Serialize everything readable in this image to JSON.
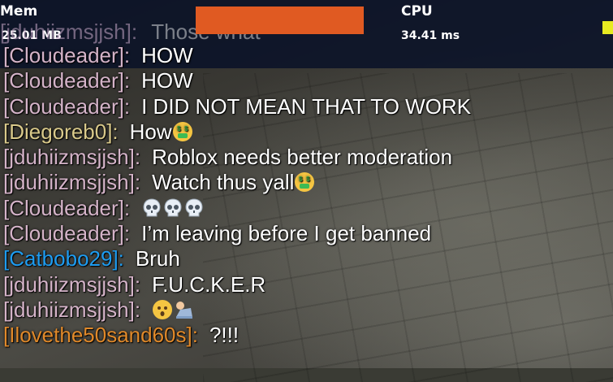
{
  "stats": {
    "mem_label": "Mem",
    "mem_value": "25.01 MB",
    "cpu_label": "CPU",
    "cpu_value": "34.41 ms"
  },
  "partial_line": {
    "name": "[jduhiizmsjjsh]:",
    "text": "Those what"
  },
  "messages": [
    {
      "name": "[Cloudeader]:",
      "text": "HOW",
      "name_color": "#d4b3c8"
    },
    {
      "name": "[Cloudeader]:",
      "text": "HOW",
      "name_color": "#d4b3c8"
    },
    {
      "name": "[Cloudeader]:",
      "text": "I DID NOT MEAN THAT TO WORK",
      "name_color": "#d4b3c8"
    },
    {
      "name": "[Diegoreb0]:",
      "text": "How",
      "name_color": "#d9c98a",
      "emoji": [
        "money-mouth-face-icon"
      ]
    },
    {
      "name": "[jduhiizmsjjsh]:",
      "text": "Roblox needs better moderation",
      "name_color": "#d4b3c8"
    },
    {
      "name": "[jduhiizmsjjsh]:",
      "text": "Watch thus yall",
      "name_color": "#d4b3c8",
      "emoji": [
        "money-mouth-face-icon"
      ]
    },
    {
      "name": "[Cloudeader]:",
      "text": "",
      "name_color": "#d4b3c8",
      "emoji": [
        "skull-icon",
        "skull-icon",
        "skull-icon"
      ]
    },
    {
      "name": "[Cloudeader]:",
      "text": "I’m leaving before I get banned",
      "name_color": "#d4b3c8"
    },
    {
      "name": "[Catbobo29]:",
      "text": "Bruh",
      "name_color": "#1e9cf0"
    },
    {
      "name": "[jduhiizmsjjsh]:",
      "text": "F.U.C.K.E.R",
      "name_color": "#d4b3c8"
    },
    {
      "name": "[jduhiizmsjjsh]:",
      "text": "",
      "name_color": "#d4b3c8",
      "emoji": [
        "hushed-face-icon",
        "person-bowing-icon"
      ]
    },
    {
      "name": "[Ilovethe50sand60s]:",
      "text": "?!!!",
      "name_color": "#e0892a"
    }
  ],
  "colors": {
    "redaction": "#e05a22",
    "stats_background": "#0a1228",
    "yellow_indicator": "#e7ea21"
  }
}
